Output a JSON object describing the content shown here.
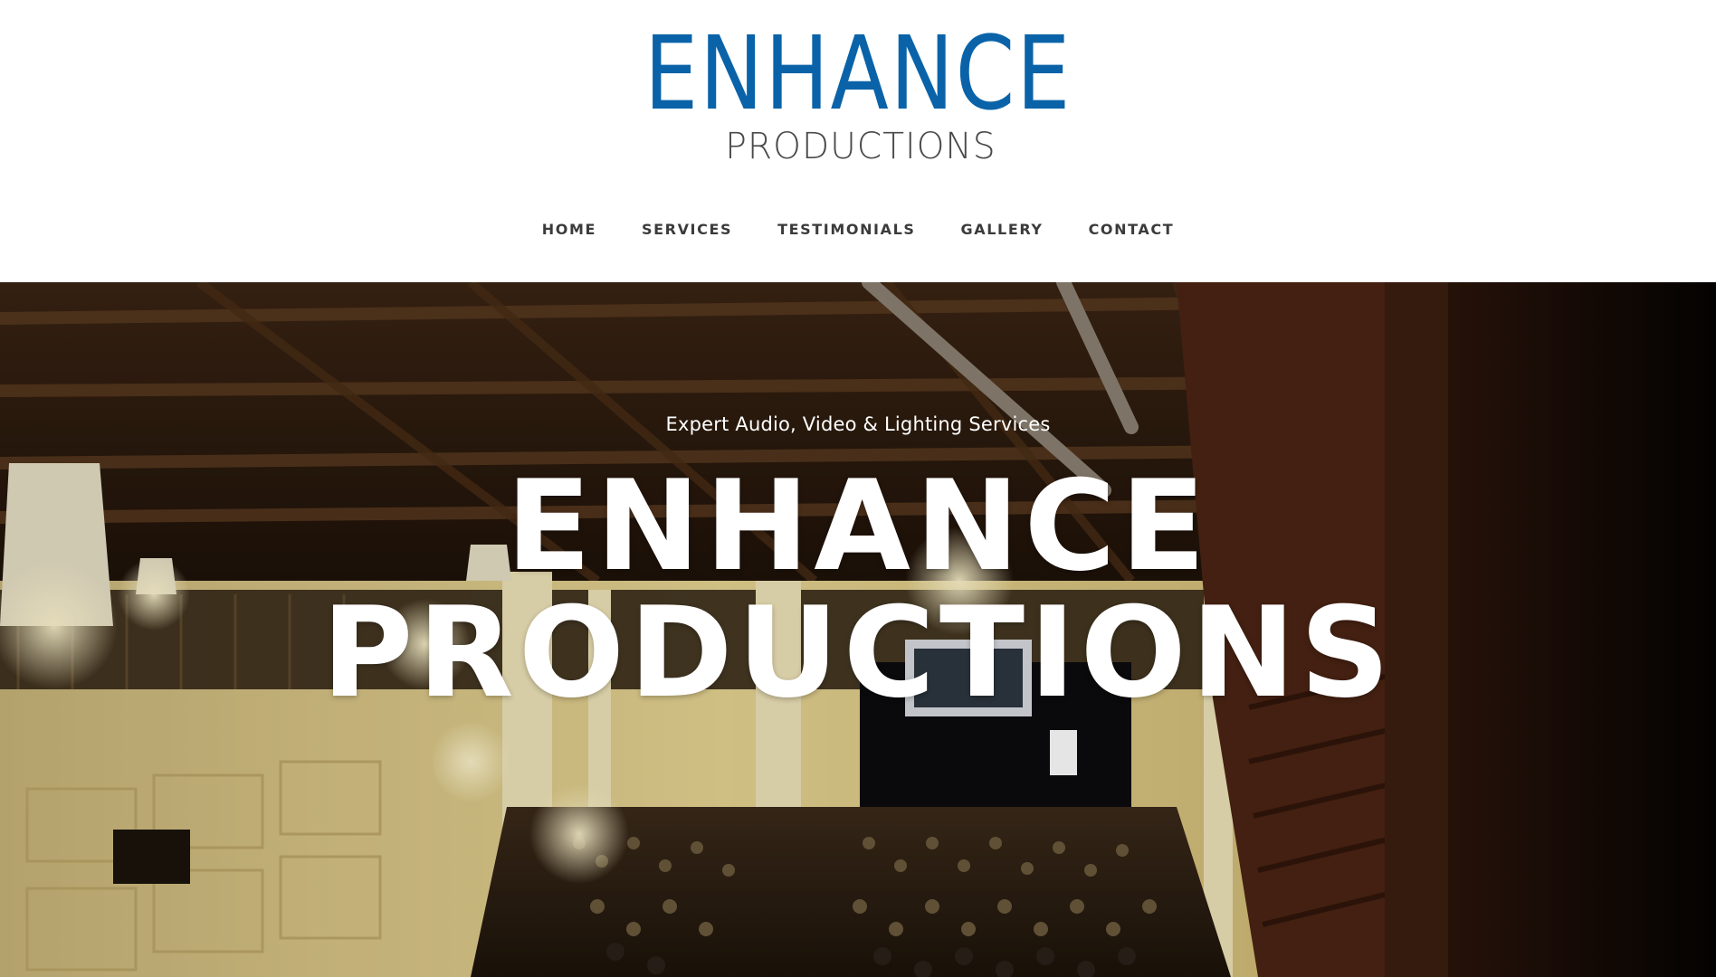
{
  "brand": {
    "logo_main": "ENHANCE",
    "logo_sub": "PRODUCTIONS",
    "logo_color": "#0a63a8"
  },
  "nav": {
    "items": [
      {
        "label": "HOME"
      },
      {
        "label": "SERVICES"
      },
      {
        "label": "TESTIMONIALS"
      },
      {
        "label": "GALLERY"
      },
      {
        "label": "CONTACT"
      }
    ]
  },
  "hero": {
    "tagline": "Expert Audio, Video & Lighting Services",
    "title_line1": "ENHANCE",
    "title_line2": "PRODUCTIONS"
  }
}
